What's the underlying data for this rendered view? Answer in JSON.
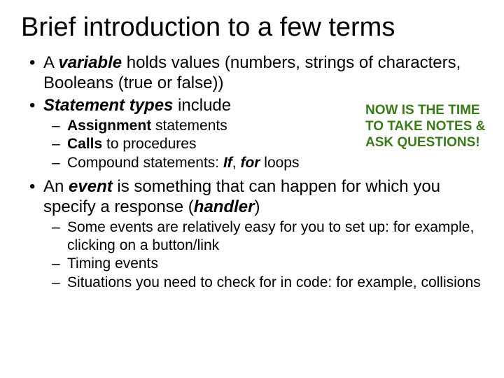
{
  "title": "Brief introduction to a few terms",
  "callout": "NOW IS THE TIME TO TAKE NOTES & ASK QUESTIONS!",
  "bullets": {
    "b1_pre": "A ",
    "b1_bi": "variable",
    "b1_post": " holds values (numbers, strings of characters, Booleans (true or false))",
    "b2_bi": "Statement types",
    "b2_post": " include",
    "b2s1_b": "Assignment",
    "b2s1_post": " statements",
    "b2s2_b": "Calls",
    "b2s2_post": " to procedures",
    "b2s3_pre": "Compound statements: ",
    "b2s3_bi1": "If",
    "b2s3_mid": ", ",
    "b2s3_bi2": "for",
    "b2s3_post": " loops",
    "b3_pre": "An ",
    "b3_bi": "event",
    "b3_mid": " is something that can happen for which you specify a response (",
    "b3_bi2": "handler",
    "b3_post": ")",
    "b3s1": " Some events are relatively easy for you to set up: for example, clicking on a button/link",
    "b3s2": " Timing events",
    "b3s3": " Situations you need to check for in code: for example, collisions"
  }
}
